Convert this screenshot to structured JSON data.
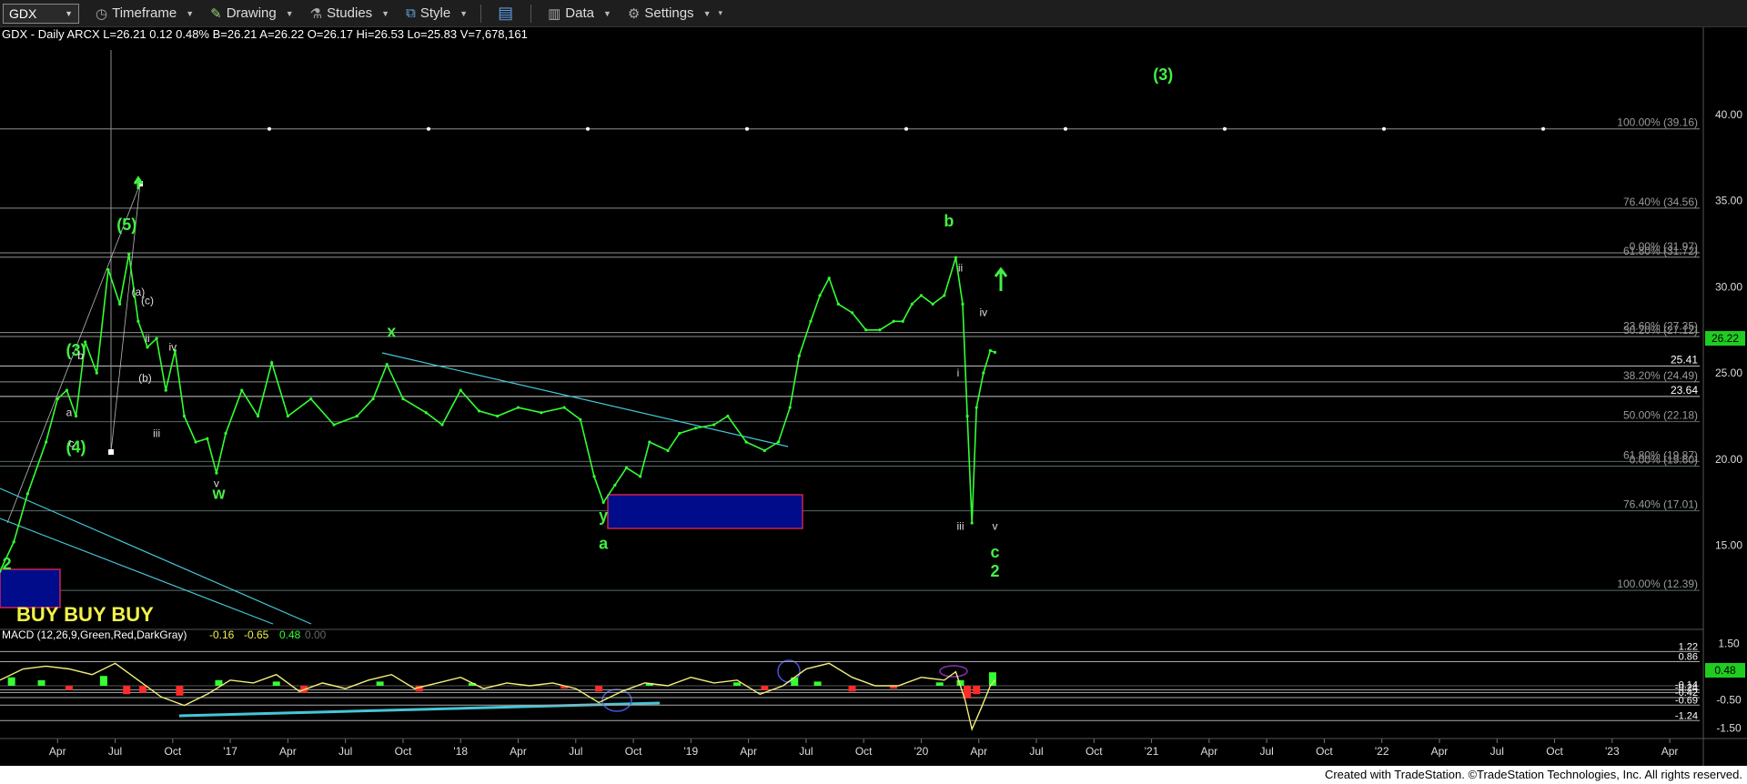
{
  "toolbar": {
    "symbol": "GDX",
    "timeframe": "Timeframe",
    "drawing": "Drawing",
    "studies": "Studies",
    "style": "Style",
    "data": "Data",
    "settings": "Settings"
  },
  "header": {
    "line": "GDX - Daily  ARCX  L=26.21  0.12  0.48%  B=26.21  A=26.22  O=26.17  Hi=26.53  Lo=25.83  V=7,678,161"
  },
  "footer": {
    "text": "Created with TradeStation. ©TradeStation Technologies, Inc. All rights reserved."
  },
  "colors": {
    "price": "#33ff33",
    "wave_label": "#44ee44",
    "fib": "#8e8e8e",
    "trendline": "#45c6d6",
    "box": "#000c8a",
    "buy_text": "#f2f24a",
    "macd_up": "#33ff33",
    "macd_down": "#ff2a2a",
    "macd_line": "#f0f07a"
  },
  "chart_data": {
    "type": "line",
    "title": "GDX - Daily",
    "x_ticks": [
      "Apr",
      "Jul",
      "Oct",
      "'17",
      "Apr",
      "Jul",
      "Oct",
      "'18",
      "Apr",
      "Jul",
      "Oct",
      "'19",
      "Apr",
      "Jul",
      "Oct",
      "'20",
      "Apr",
      "Jul",
      "Oct",
      "'21",
      "Apr",
      "Jul",
      "Oct",
      "'22",
      "Apr",
      "Jul",
      "Oct",
      "'23",
      "Apr"
    ],
    "y_ticks": [
      15,
      20,
      25,
      30,
      35,
      40
    ],
    "ylim": [
      10.5,
      44
    ],
    "last_price": "26.22",
    "series": [
      {
        "name": "GDX",
        "points": [
          [
            2016.0,
            13.5
          ],
          [
            2016.06,
            15.2
          ],
          [
            2016.12,
            18
          ],
          [
            2016.2,
            21
          ],
          [
            2016.25,
            23.5
          ],
          [
            2016.29,
            24
          ],
          [
            2016.33,
            22.5
          ],
          [
            2016.37,
            26.8
          ],
          [
            2016.42,
            25
          ],
          [
            2016.47,
            31
          ],
          [
            2016.52,
            29
          ],
          [
            2016.56,
            31.9
          ],
          [
            2016.6,
            28
          ],
          [
            2016.64,
            26.5
          ],
          [
            2016.68,
            27
          ],
          [
            2016.72,
            24
          ],
          [
            2016.76,
            26.3
          ],
          [
            2016.8,
            22.5
          ],
          [
            2016.85,
            21
          ],
          [
            2016.9,
            21.2
          ],
          [
            2016.94,
            19.2
          ],
          [
            2016.98,
            21.5
          ],
          [
            2017.05,
            24
          ],
          [
            2017.12,
            22.5
          ],
          [
            2017.18,
            25.6
          ],
          [
            2017.25,
            22.5
          ],
          [
            2017.35,
            23.5
          ],
          [
            2017.45,
            22
          ],
          [
            2017.55,
            22.5
          ],
          [
            2017.62,
            23.5
          ],
          [
            2017.68,
            25.5
          ],
          [
            2017.75,
            23.5
          ],
          [
            2017.85,
            22.7
          ],
          [
            2017.92,
            22
          ],
          [
            2018.0,
            24
          ],
          [
            2018.08,
            22.8
          ],
          [
            2018.16,
            22.5
          ],
          [
            2018.25,
            23
          ],
          [
            2018.35,
            22.7
          ],
          [
            2018.45,
            23
          ],
          [
            2018.52,
            22.3
          ],
          [
            2018.58,
            19
          ],
          [
            2018.62,
            17.5
          ],
          [
            2018.67,
            18.5
          ],
          [
            2018.72,
            19.5
          ],
          [
            2018.78,
            19
          ],
          [
            2018.82,
            21
          ],
          [
            2018.9,
            20.5
          ],
          [
            2018.95,
            21.5
          ],
          [
            2019.02,
            21.8
          ],
          [
            2019.1,
            22
          ],
          [
            2019.16,
            22.5
          ],
          [
            2019.24,
            21
          ],
          [
            2019.32,
            20.5
          ],
          [
            2019.38,
            21
          ],
          [
            2019.43,
            23
          ],
          [
            2019.47,
            26
          ],
          [
            2019.52,
            28
          ],
          [
            2019.56,
            29.5
          ],
          [
            2019.6,
            30.5
          ],
          [
            2019.64,
            29
          ],
          [
            2019.7,
            28.5
          ],
          [
            2019.76,
            27.5
          ],
          [
            2019.82,
            27.5
          ],
          [
            2019.88,
            28
          ],
          [
            2019.92,
            28
          ],
          [
            2019.96,
            29
          ],
          [
            2020.0,
            29.5
          ],
          [
            2020.05,
            29
          ],
          [
            2020.1,
            29.5
          ],
          [
            2020.15,
            31.7
          ],
          [
            2020.18,
            29
          ],
          [
            2020.2,
            22.5
          ],
          [
            2020.22,
            16.3
          ],
          [
            2020.24,
            23
          ],
          [
            2020.27,
            25
          ],
          [
            2020.3,
            26.3
          ],
          [
            2020.32,
            26.2
          ]
        ]
      }
    ],
    "levels": [
      {
        "label": "100.00% (39.16)",
        "value": 39.16
      },
      {
        "label": "76.40% (34.56)",
        "value": 34.56
      },
      {
        "label": "61.80% (31.72)",
        "value": 31.72
      },
      {
        "label": "0.00% (31.97)",
        "value": 31.97
      },
      {
        "label": "23.60% (27.35)",
        "value": 27.35
      },
      {
        "label": "30.20% (27.12)",
        "value": 27.12
      },
      {
        "label": "25.41",
        "value": 25.41
      },
      {
        "label": "38.20% (24.49)",
        "value": 24.49
      },
      {
        "label": "23.64",
        "value": 23.64
      },
      {
        "label": "50.00% (22.18)",
        "value": 22.18
      },
      {
        "label": "61.80% (19.87)",
        "value": 19.87
      },
      {
        "label": "0.00% (19.60)",
        "value": 19.6
      },
      {
        "label": "76.40% (17.01)",
        "value": 17.01
      },
      {
        "label": "100.00% (12.39)",
        "value": 12.39
      }
    ],
    "wave_labels": [
      {
        "text": "(3)",
        "x": 2021.05,
        "y": 42
      },
      {
        "text": "b",
        "x": 2020.12,
        "y": 33.5
      },
      {
        "text": "x",
        "x": 2017.7,
        "y": 27.1
      },
      {
        "text": "w",
        "x": 2016.95,
        "y": 17.7
      },
      {
        "text": "y",
        "x": 2018.62,
        "y": 16.4
      },
      {
        "text": "a",
        "x": 2018.62,
        "y": 14.8
      },
      {
        "text": "c",
        "x": 2020.32,
        "y": 14.3
      },
      {
        "text": "2",
        "x": 2020.32,
        "y": 13.2
      },
      {
        "text": "(5)",
        "x": 2016.55,
        "y": 33.3
      },
      {
        "text": "(3)",
        "x": 2016.33,
        "y": 26
      },
      {
        "text": "(4)",
        "x": 2016.33,
        "y": 20.4
      },
      {
        "text": "2",
        "x": 2016.03,
        "y": 13.6
      }
    ],
    "sub_labels": [
      {
        "text": "ii",
        "x": 2020.17,
        "y": 30.9
      },
      {
        "text": "iv",
        "x": 2020.27,
        "y": 28.3
      },
      {
        "text": "i",
        "x": 2020.16,
        "y": 24.8
      },
      {
        "text": "iii",
        "x": 2020.17,
        "y": 15.9
      },
      {
        "text": "v",
        "x": 2020.32,
        "y": 15.9
      },
      {
        "text": "(a)",
        "x": 2016.6,
        "y": 29.5
      },
      {
        "text": "(c)",
        "x": 2016.64,
        "y": 29.0
      },
      {
        "text": "ii",
        "x": 2016.64,
        "y": 26.8
      },
      {
        "text": "iv",
        "x": 2016.75,
        "y": 26.3
      },
      {
        "text": "(b)",
        "x": 2016.63,
        "y": 24.5
      },
      {
        "text": "iii",
        "x": 2016.68,
        "y": 21.3
      },
      {
        "text": "v",
        "x": 2016.94,
        "y": 18.4
      },
      {
        "text": "b",
        "x": 2016.35,
        "y": 25.8
      },
      {
        "text": "a",
        "x": 2016.3,
        "y": 22.5
      },
      {
        "text": "c",
        "x": 2016.31,
        "y": 20.7
      }
    ],
    "annotation": "BUY BUY BUY",
    "macd": {
      "label": "MACD (12,26,9,Green,Red,DarkGray)",
      "values": [
        "-0.16",
        "-0.65",
        "0.48",
        "0.00"
      ],
      "y_ticks": [
        1.5,
        -0.5,
        -1.5
      ],
      "ylim": [
        -1.75,
        1.75
      ],
      "last": "0.48",
      "levels": [
        {
          "label": "1.22",
          "value": 1.22
        },
        {
          "label": "0.86",
          "value": 0.86
        },
        {
          "label": "-0.14",
          "value": -0.14
        },
        {
          "label": "-0.24",
          "value": -0.24
        },
        {
          "label": "-0.42",
          "value": -0.42
        },
        {
          "label": "-0.69",
          "value": -0.69
        },
        {
          "label": "-1.24",
          "value": -1.24
        }
      ],
      "line_points": [
        [
          2016.0,
          0.2
        ],
        [
          2016.1,
          0.6
        ],
        [
          2016.2,
          0.7
        ],
        [
          2016.3,
          0.6
        ],
        [
          2016.4,
          0.4
        ],
        [
          2016.5,
          0.8
        ],
        [
          2016.6,
          0.2
        ],
        [
          2016.7,
          -0.4
        ],
        [
          2016.8,
          -0.7
        ],
        [
          2016.9,
          -0.3
        ],
        [
          2017.0,
          0.2
        ],
        [
          2017.1,
          0.1
        ],
        [
          2017.2,
          0.4
        ],
        [
          2017.3,
          -0.2
        ],
        [
          2017.4,
          0.1
        ],
        [
          2017.5,
          -0.1
        ],
        [
          2017.6,
          0.2
        ],
        [
          2017.7,
          0.4
        ],
        [
          2017.8,
          -0.1
        ],
        [
          2017.9,
          0.1
        ],
        [
          2018.0,
          0.3
        ],
        [
          2018.1,
          -0.1
        ],
        [
          2018.2,
          0.1
        ],
        [
          2018.3,
          0.0
        ],
        [
          2018.4,
          0.1
        ],
        [
          2018.5,
          -0.1
        ],
        [
          2018.6,
          -0.6
        ],
        [
          2018.7,
          -0.2
        ],
        [
          2018.8,
          0.1
        ],
        [
          2018.9,
          0.0
        ],
        [
          2019.0,
          0.3
        ],
        [
          2019.1,
          0.1
        ],
        [
          2019.2,
          0.2
        ],
        [
          2019.3,
          -0.3
        ],
        [
          2019.4,
          0.0
        ],
        [
          2019.5,
          0.6
        ],
        [
          2019.6,
          0.8
        ],
        [
          2019.7,
          0.3
        ],
        [
          2019.8,
          0.0
        ],
        [
          2019.9,
          0.0
        ],
        [
          2020.0,
          0.3
        ],
        [
          2020.1,
          0.2
        ],
        [
          2020.15,
          0.5
        ],
        [
          2020.19,
          -0.5
        ],
        [
          2020.22,
          -1.55
        ],
        [
          2020.26,
          -0.8
        ],
        [
          2020.3,
          0.0
        ],
        [
          2020.32,
          0.2
        ]
      ],
      "hist": [
        [
          2016.05,
          0.3
        ],
        [
          2016.18,
          0.2
        ],
        [
          2016.3,
          -0.15
        ],
        [
          2016.45,
          0.35
        ],
        [
          2016.55,
          -0.3
        ],
        [
          2016.62,
          -0.25
        ],
        [
          2016.78,
          -0.35
        ],
        [
          2016.95,
          0.2
        ],
        [
          2017.2,
          0.15
        ],
        [
          2017.32,
          -0.25
        ],
        [
          2017.65,
          0.15
        ],
        [
          2017.82,
          -0.2
        ],
        [
          2018.05,
          0.1
        ],
        [
          2018.45,
          -0.1
        ],
        [
          2018.6,
          -0.2
        ],
        [
          2018.82,
          0.1
        ],
        [
          2019.2,
          0.12
        ],
        [
          2019.32,
          -0.15
        ],
        [
          2019.45,
          0.3
        ],
        [
          2019.55,
          0.15
        ],
        [
          2019.7,
          -0.2
        ],
        [
          2019.88,
          -0.1
        ],
        [
          2020.08,
          0.12
        ],
        [
          2020.17,
          0.2
        ],
        [
          2020.2,
          -0.45
        ],
        [
          2020.24,
          -0.3
        ],
        [
          2020.31,
          0.48
        ]
      ]
    }
  }
}
